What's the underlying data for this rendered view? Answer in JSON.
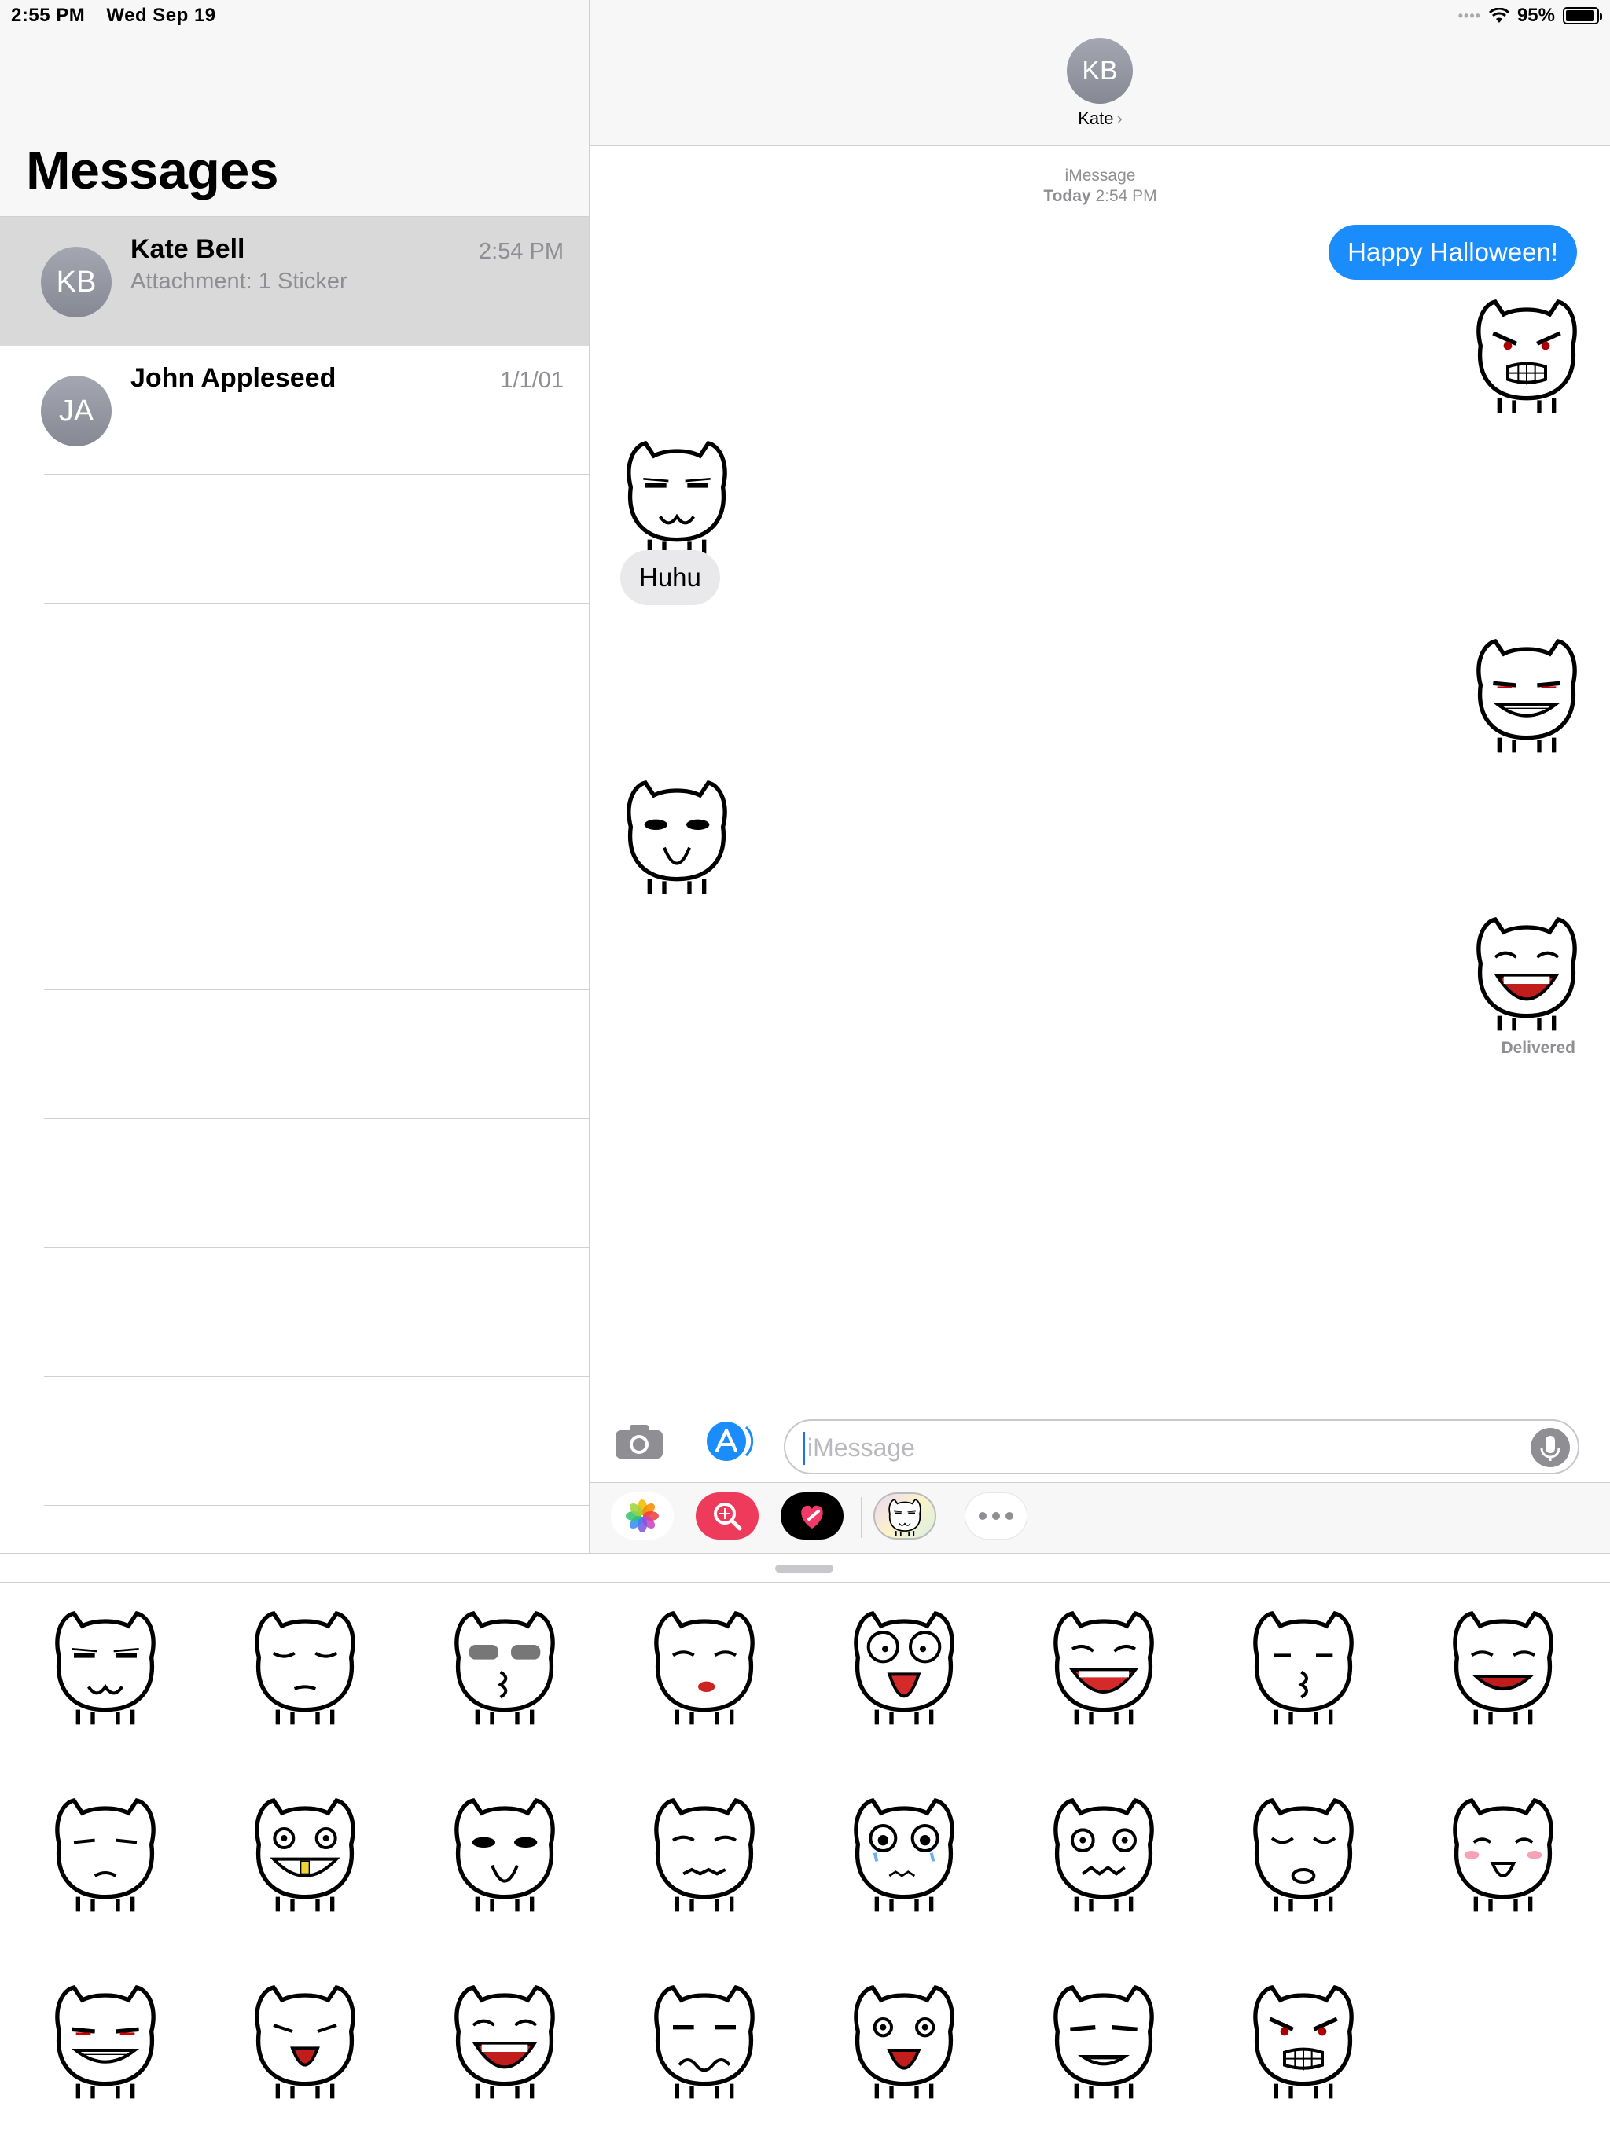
{
  "status_bar": {
    "time": "2:55 PM",
    "date": "Wed Sep 19",
    "battery_text": "95%",
    "battery_level": 0.95,
    "wifi_icon": "wifi-icon"
  },
  "sidebar": {
    "title": "Messages",
    "conversations": [
      {
        "initials": "KB",
        "name": "Kate Bell",
        "time": "2:54 PM",
        "preview": "Attachment: 1 Sticker",
        "selected": true
      },
      {
        "initials": "JA",
        "name": "John Appleseed",
        "time": "1/1/01",
        "preview": "",
        "selected": false
      }
    ]
  },
  "chat": {
    "contact_initials": "KB",
    "contact_name": "Kate",
    "service": "iMessage",
    "timestamp_day": "Today",
    "timestamp_time": "2:54 PM",
    "messages": [
      {
        "type": "text",
        "direction": "outgoing",
        "text": "Happy Halloween!"
      },
      {
        "type": "sticker",
        "direction": "outgoing",
        "face": "angry"
      },
      {
        "type": "sticker",
        "direction": "incoming",
        "face": "smug"
      },
      {
        "type": "text",
        "direction": "incoming",
        "text": "Huhu"
      },
      {
        "type": "sticker",
        "direction": "outgoing",
        "face": "evil-grin"
      },
      {
        "type": "sticker",
        "direction": "incoming",
        "face": "whistle"
      },
      {
        "type": "sticker",
        "direction": "outgoing",
        "face": "laugh"
      }
    ],
    "delivered_label": "Delivered"
  },
  "compose": {
    "placeholder": "iMessage",
    "camera_icon": "camera-icon",
    "appstore_icon": "app-store-icon",
    "mic_icon": "microphone-icon"
  },
  "app_drawer": {
    "apps": [
      "photos-app-icon",
      "search-images-app-icon",
      "digital-touch-app-icon",
      "sticker-pack-app-icon",
      "more-apps-icon"
    ]
  },
  "sticker_keyboard": {
    "stickers": [
      "smug",
      "tired",
      "kiss-glasses",
      "disgust",
      "scream",
      "crazy-laugh",
      "kiss",
      "grin",
      "annoyed",
      "gold-tooth",
      "whistle",
      "worried",
      "cry",
      "dizzy",
      "pout",
      "blush",
      "evil-grin",
      "yell",
      "laugh",
      "wobbly",
      "gasp",
      "sneer",
      "angry"
    ]
  },
  "colors": {
    "accent": "#1a8cfb",
    "incoming_bubble": "#e9e9eb",
    "secondary_text": "#8e8e93",
    "selected_row": "#d9d9d9"
  }
}
